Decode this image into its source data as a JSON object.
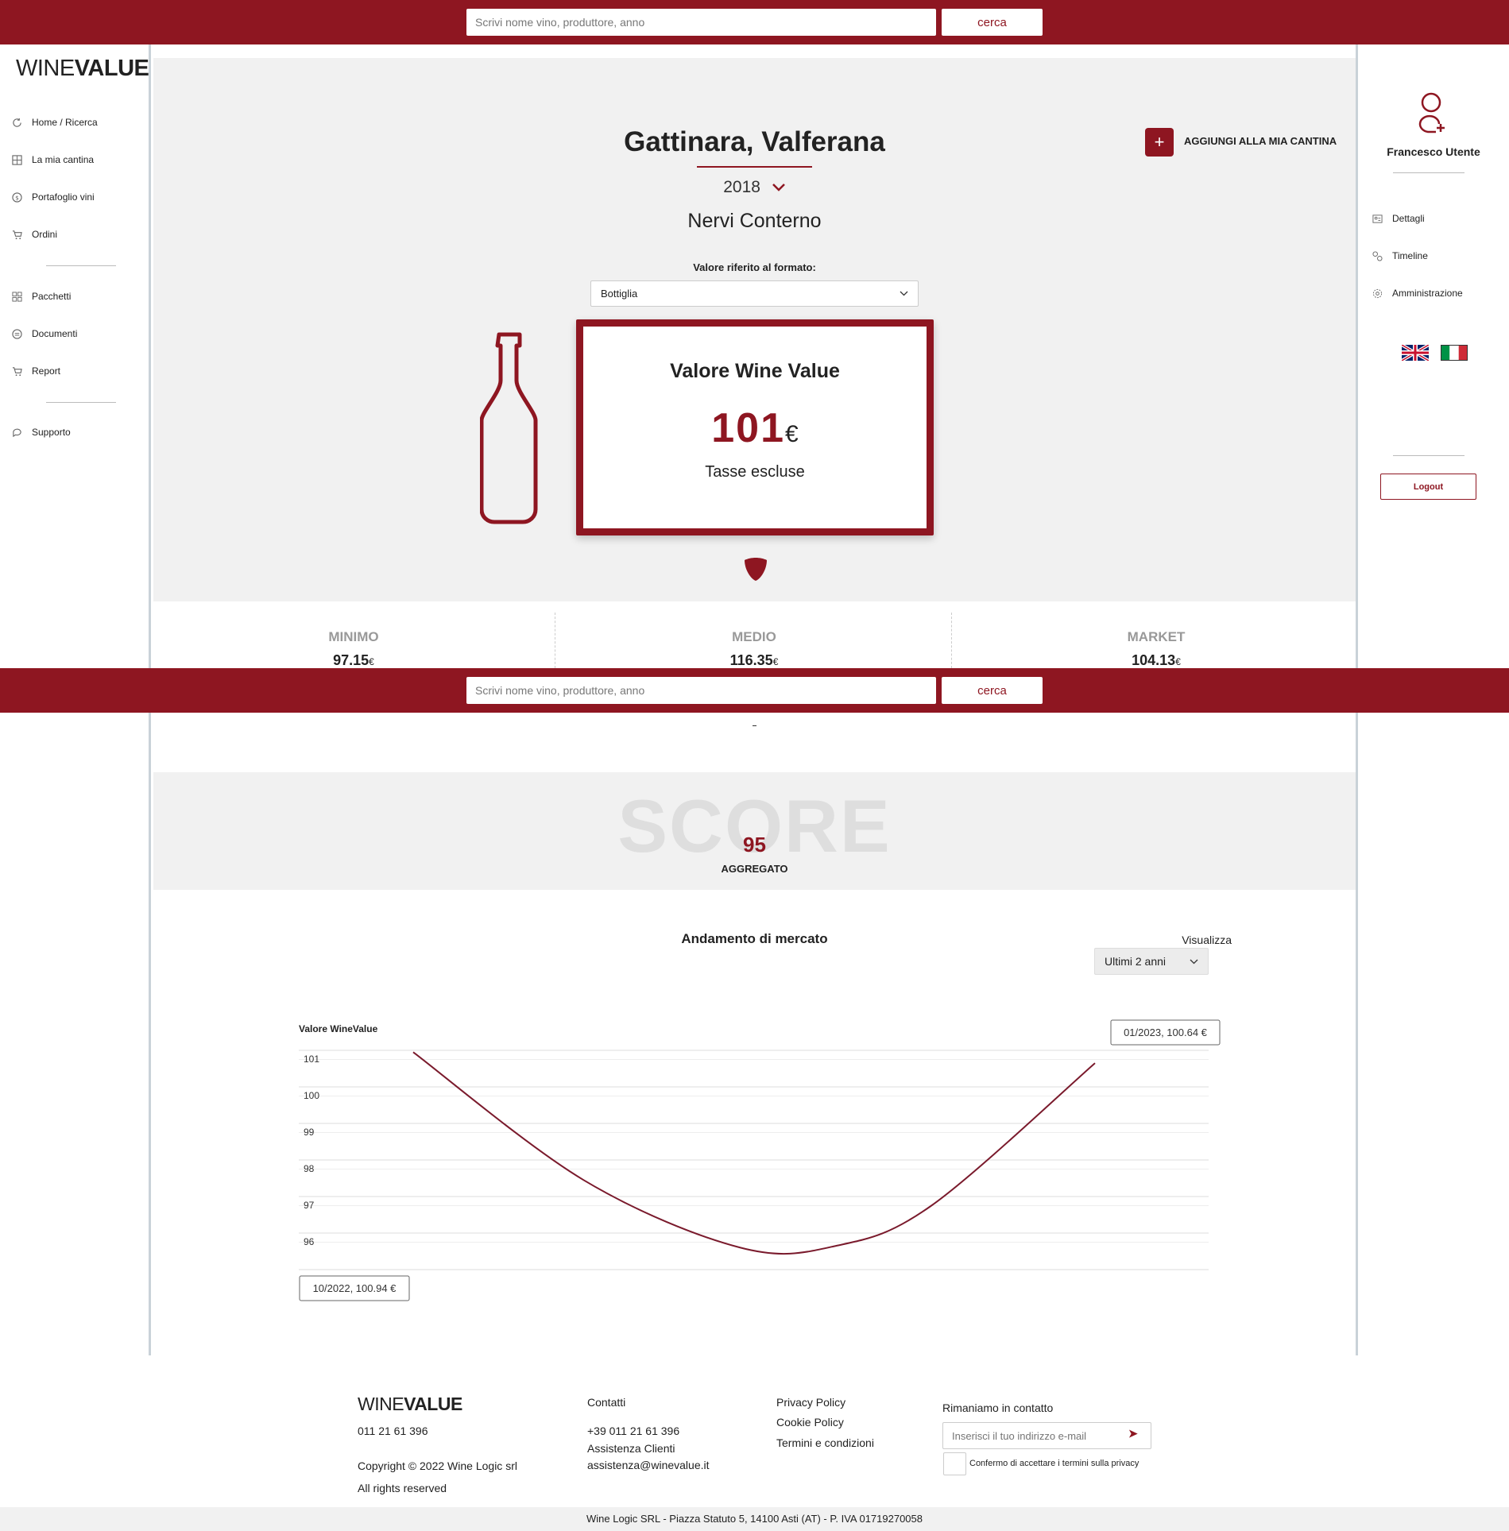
{
  "header": {
    "search_placeholder": "Scrivi nome vino, produttore, anno",
    "search_button": "cerca"
  },
  "sidebar": {
    "logo_light": "WINE",
    "logo_bold": "VALUE",
    "items": [
      {
        "label": "Home / Ricerca",
        "icon": "refresh-icon"
      },
      {
        "label": "La mia cantina",
        "icon": "cellar-icon"
      },
      {
        "label": "Portafoglio vini",
        "icon": "dollar-icon"
      },
      {
        "label": "Ordini",
        "icon": "cart-icon"
      },
      {
        "label": "Pacchetti",
        "icon": "grid-icon"
      },
      {
        "label": "Documenti",
        "icon": "document-icon"
      },
      {
        "label": "Report",
        "icon": "report-icon"
      },
      {
        "label": "Supporto",
        "icon": "chat-icon"
      }
    ]
  },
  "user": {
    "name": "Francesco Utente",
    "items": [
      {
        "label": "Dettagli",
        "icon": "id-card-icon"
      },
      {
        "label": "Timeline",
        "icon": "timeline-icon"
      },
      {
        "label": "Amministrazione",
        "icon": "gear-icon"
      }
    ],
    "logout": "Logout"
  },
  "wine": {
    "name": "Gattinara, Valferana",
    "year": "2018",
    "producer": "Nervi Conterno",
    "add_to_cellar": "AGGIUNGI ALLA MIA CANTINA",
    "format_label": "Valore riferito al formato:",
    "format_value": "Bottiglia",
    "value_title": "Valore Wine Value",
    "value": "101",
    "currency": "€",
    "tax_note": "Tasse escluse"
  },
  "stats": [
    {
      "label": "MINIMO",
      "value": "97.15",
      "currency": "€"
    },
    {
      "label": "MEDIO",
      "value": "116.35",
      "currency": "€"
    },
    {
      "label": "MARKET",
      "value": "104.13",
      "currency": "€"
    }
  ],
  "score": {
    "background_text": "SCORE",
    "value": "95",
    "label": "AGGREGATO"
  },
  "market": {
    "title": "Andamento di mercato",
    "view_label": "Visualizza",
    "view_value": "Ultimi 2 anni"
  },
  "chart_data": {
    "type": "line",
    "ylabel": "Valore WineValue",
    "yticks": [
      101,
      100,
      99,
      98,
      97,
      96
    ],
    "ylim": [
      95.25,
      101.25
    ],
    "grid": true,
    "series": [
      {
        "points": [
          [
            0,
            101.2
          ],
          [
            0.25,
            97.7
          ],
          [
            0.48,
            95.85
          ],
          [
            0.62,
            95.9
          ],
          [
            0.76,
            97.0
          ],
          [
            1,
            100.9
          ]
        ]
      }
    ],
    "annotations": [
      {
        "text": "10/2022, 100.94 €",
        "position": "bottom-left"
      },
      {
        "text": "01/2023, 100.64 €",
        "position": "top-right"
      }
    ]
  },
  "footer": {
    "logo_light": "WINE",
    "logo_bold": "VALUE",
    "phone": "011 21 61 396",
    "copyright": "Copyright © 2022 Wine Logic srl",
    "rights": "All rights reserved",
    "contacts_title": "Contatti",
    "contacts_phone": "+39 011 21 61 396",
    "assistance": "Assistenza Clienti",
    "email": "assistenza@winevalue.it",
    "links": [
      "Privacy Policy",
      "Cookie Policy",
      "Termini e condizioni"
    ],
    "newsletter_title": "Rimaniamo in contatto",
    "newsletter_placeholder": "Inserisci il tuo indirizzo e-mail",
    "send_icon": "➤",
    "privacy_note": "Confermo di accettare i termini sulla privacy",
    "company_line": "Wine Logic SRL - Piazza Statuto 5, 14100 Asti (AT) - P. IVA 01719270058"
  },
  "colors": {
    "brand": "#8e1621",
    "panel": "#f1f1f1"
  }
}
